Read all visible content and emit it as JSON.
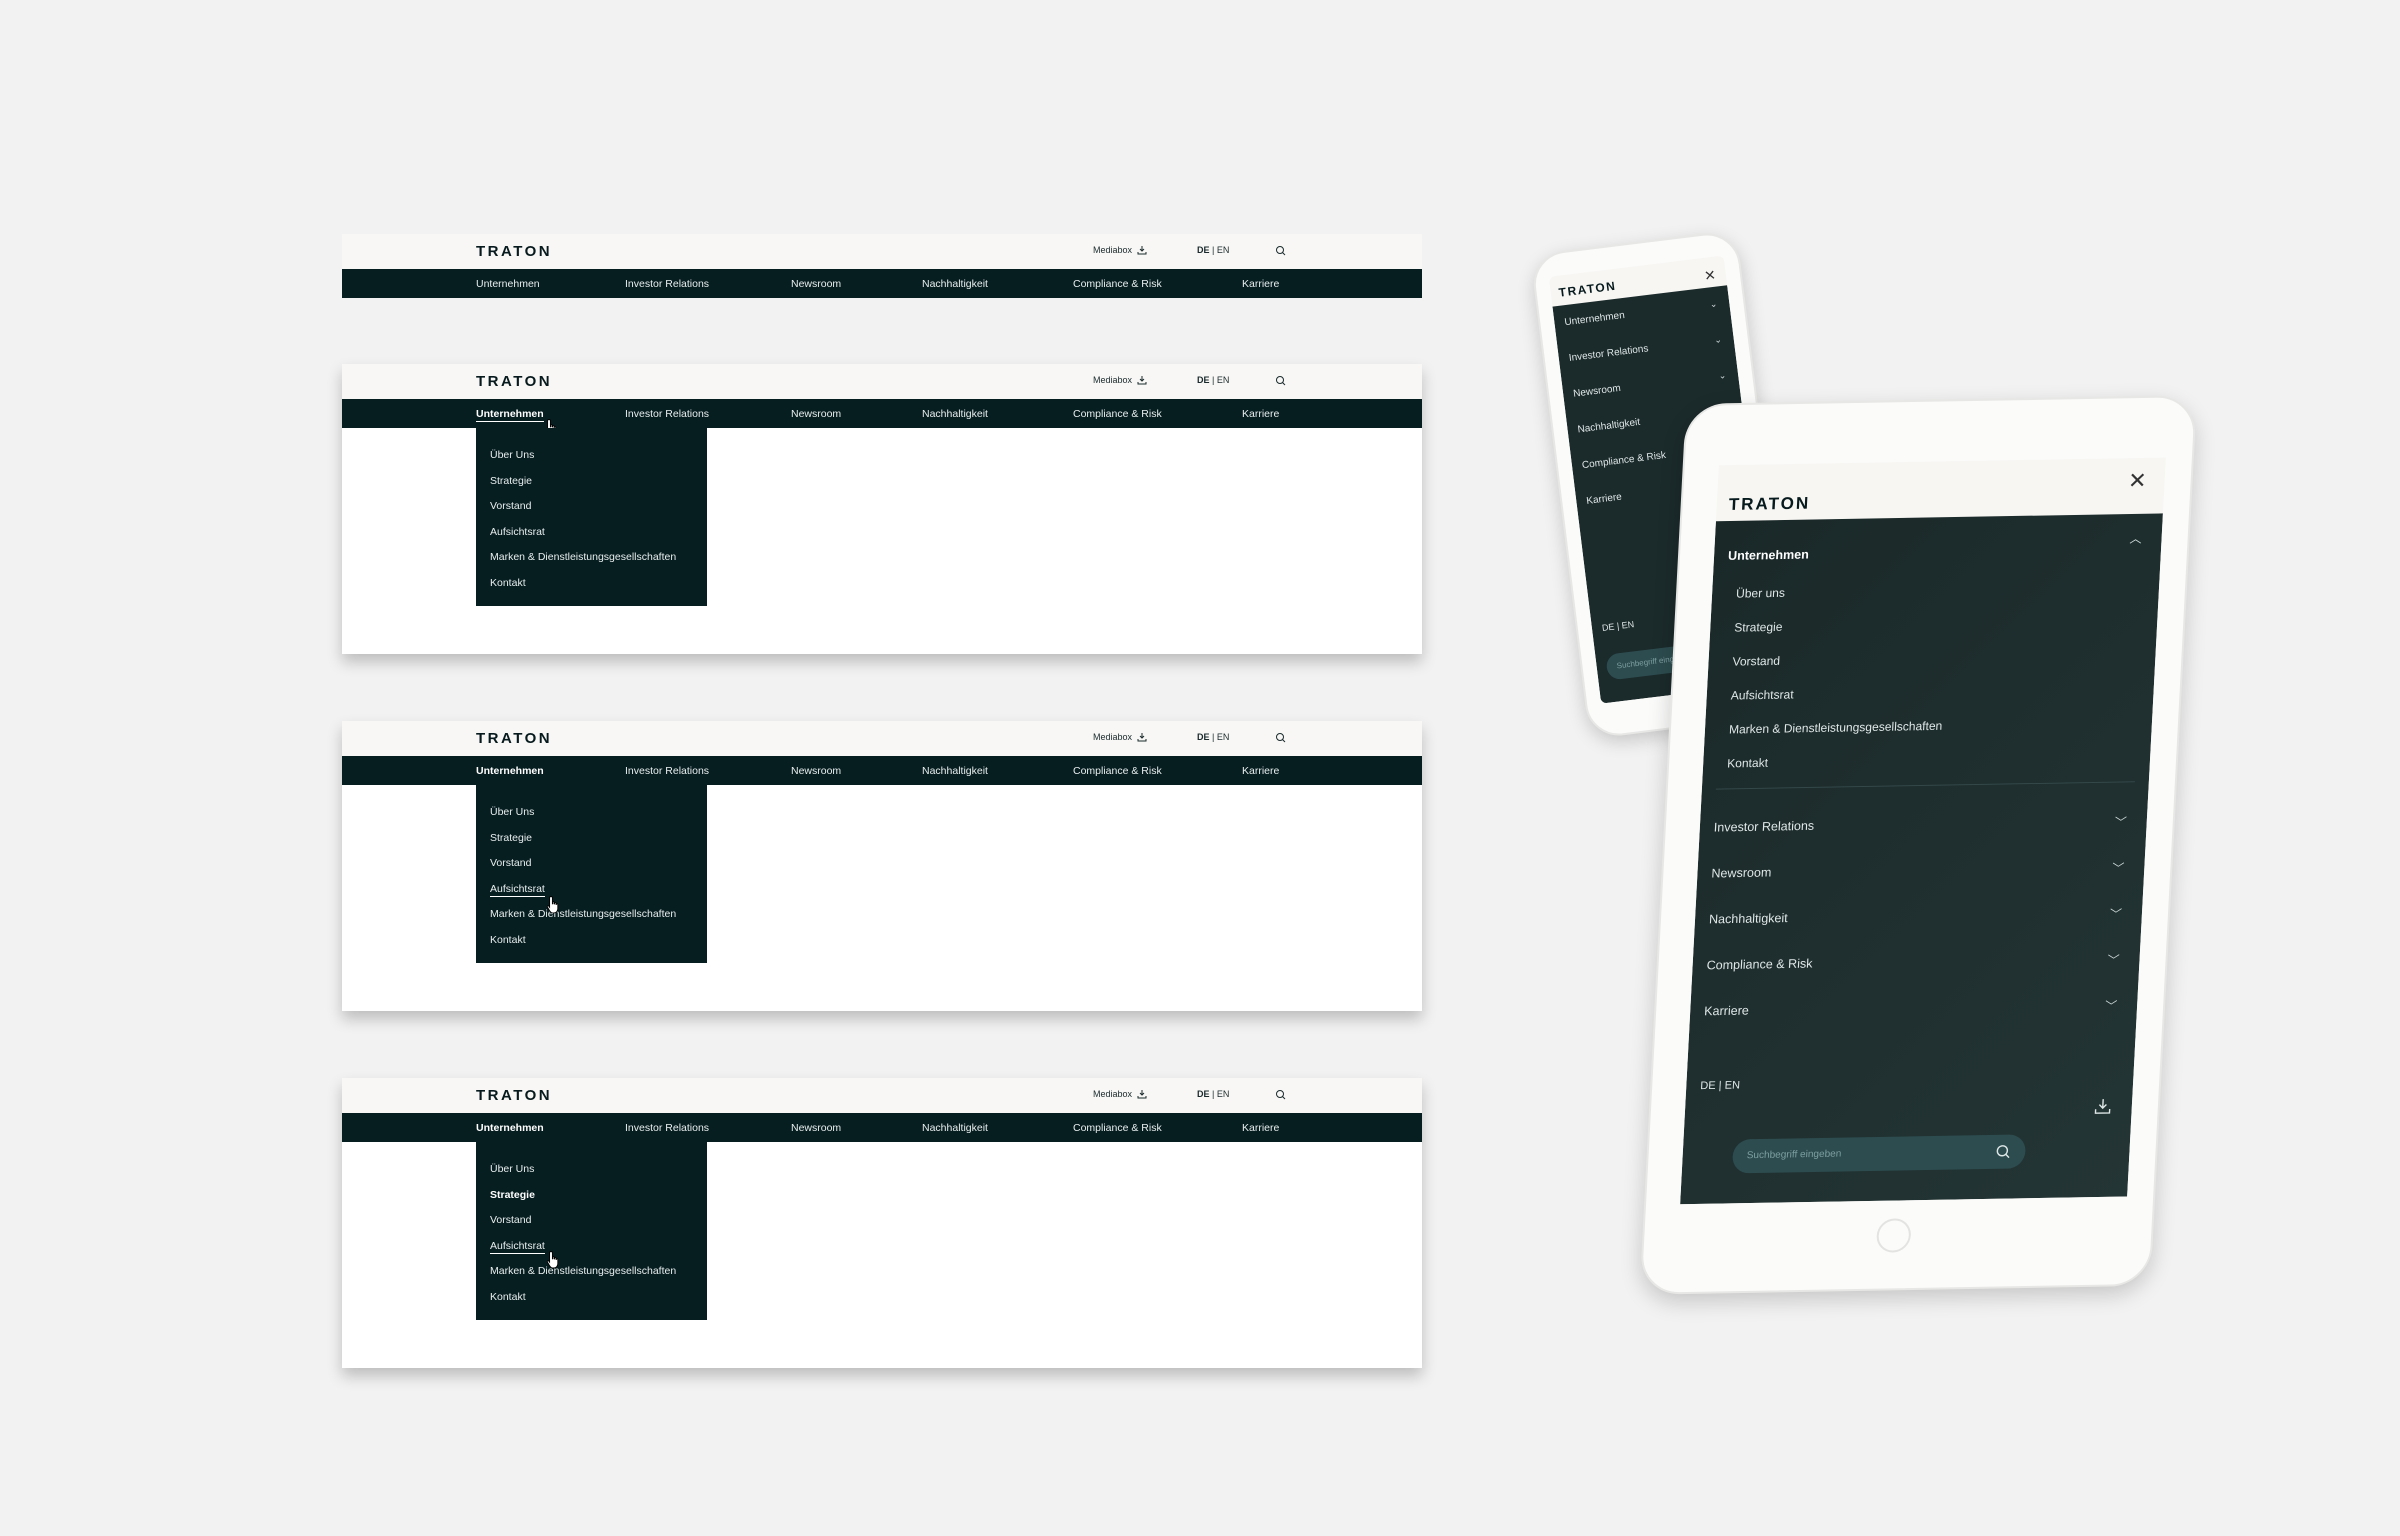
{
  "brand": {
    "logo": "TRATON"
  },
  "topbar": {
    "mediabox": "Mediabox",
    "lang_de": "DE",
    "lang_sep": " | ",
    "lang_en": "EN"
  },
  "nav": {
    "items": [
      "Unternehmen",
      "Investor Relations",
      "Newsroom",
      "Nachhaltigkeit",
      "Compliance & Risk",
      "Karriere"
    ]
  },
  "dropdown": {
    "items": [
      "Über Uns",
      "Strategie",
      "Vorstand",
      "Aufsichtsrat",
      "Marken & Dienstleistungsgesellschaften",
      "Kontakt"
    ]
  },
  "phone": {
    "items": [
      "Unternehmen",
      "Investor Relations",
      "Newsroom",
      "Nachhaltigkeit",
      "Compliance & Risk",
      "Karriere"
    ],
    "lang": "DE  |  EN",
    "search_placeholder": "Suchbegriff eingeben"
  },
  "tablet": {
    "group": "Unternehmen",
    "sub_items": [
      "Über uns",
      "Strategie",
      "Vorstand",
      "Aufsichtsrat",
      "Marken & Dienstleistungsgesellschaften",
      "Kontakt"
    ],
    "items": [
      "Investor Relations",
      "Newsroom",
      "Nachhaltigkeit",
      "Compliance & Risk",
      "Karriere"
    ],
    "lang": "DE  |  EN",
    "search_placeholder": "Suchbegriff eingeben"
  },
  "colors": {
    "nav_bg": "#071e21",
    "topbar_bg": "#f8f7f5",
    "mobile_menu_bg": "#1b2a2b",
    "search_bg": "#2d4c4f"
  },
  "icons": {
    "download": "download-icon",
    "search": "search-icon",
    "close": "close-icon",
    "chevron": "chevron-down-icon",
    "cursor": "hand-cursor-icon"
  }
}
